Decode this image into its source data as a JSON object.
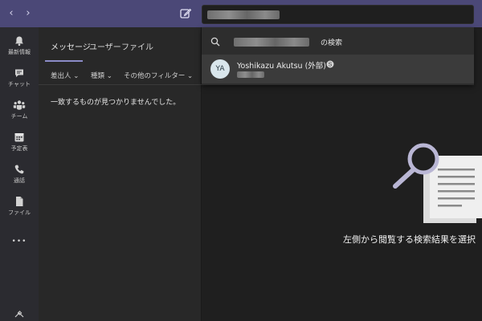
{
  "topbar": {
    "back_icon": "chevron-left-icon",
    "forward_icon": "chevron-right-icon",
    "compose_icon": "compose-icon",
    "back_glyph": "‹",
    "forward_glyph": "›"
  },
  "rail": {
    "items": [
      {
        "label": "最新情報",
        "icon": "bell-icon"
      },
      {
        "label": "チャット",
        "icon": "chat-icon"
      },
      {
        "label": "チーム",
        "icon": "teams-icon"
      },
      {
        "label": "予定表",
        "icon": "calendar-icon"
      },
      {
        "label": "通話",
        "icon": "phone-icon"
      },
      {
        "label": "ファイル",
        "icon": "file-icon"
      },
      {
        "label": "",
        "icon": "more-icon"
      }
    ],
    "more_glyph": "•••"
  },
  "listpane": {
    "tabs": [
      {
        "label": "メッセージ",
        "active": true
      },
      {
        "label": "ユーザー",
        "active": false
      },
      {
        "label": "ファイル",
        "active": false
      }
    ],
    "filters": [
      {
        "label": "差出人 ⌄"
      },
      {
        "label": "種類 ⌄"
      },
      {
        "label": "その他のフィルター ⌄"
      }
    ],
    "no_match": "一致するものが見つかりませんでした。"
  },
  "dropdown": {
    "query_suffix": "の検索",
    "result_name": "Yoshikazu Akutsu (外部)",
    "result_initials": "YA",
    "search_icon": "search-icon",
    "skype_icon": "skype-icon"
  },
  "main": {
    "message": "左側から閲覧する検索結果を選択"
  },
  "colors": {
    "topbar": "#4b4877",
    "rail": "#2b2b30",
    "tab_underline": "#8b8cc7",
    "background": "#1f1f1f"
  }
}
